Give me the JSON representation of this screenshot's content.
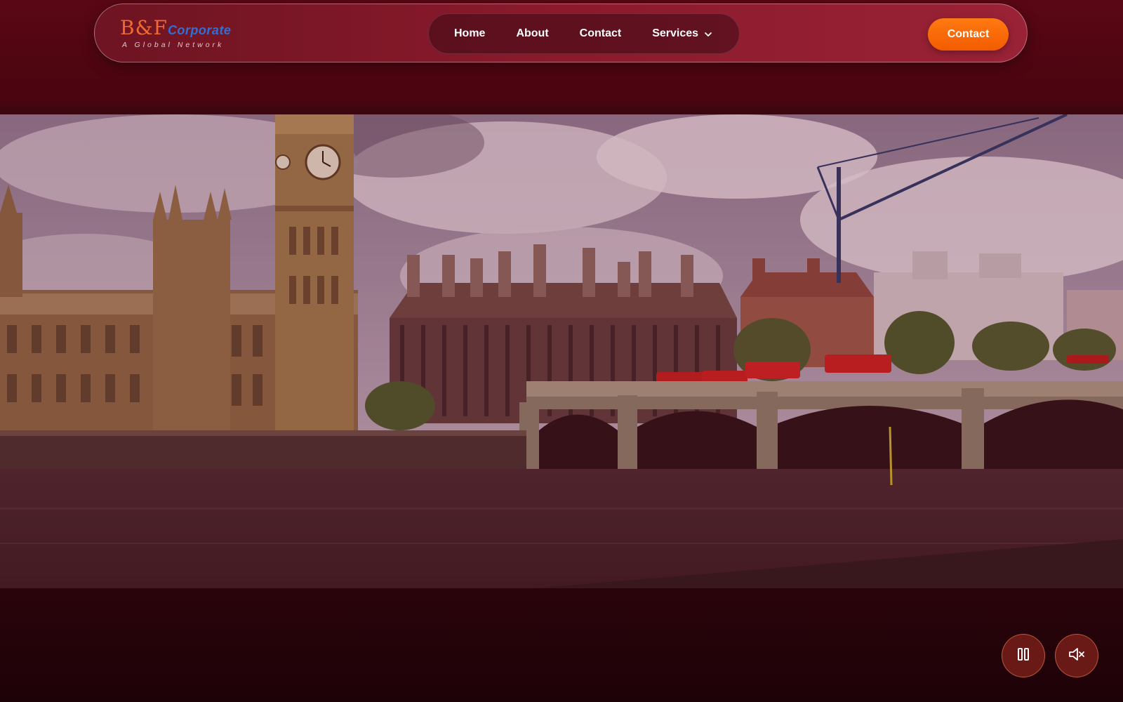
{
  "brand": {
    "logo_mark": "B&F",
    "logo_word": "Corporate",
    "tagline": "A Global Network"
  },
  "nav": {
    "items": [
      {
        "label": "Home"
      },
      {
        "label": "About"
      },
      {
        "label": "Contact"
      },
      {
        "label": "Services",
        "icon": "chevron-down-icon"
      }
    ],
    "cta_label": "Contact"
  },
  "hero": {
    "media": "video-background-westminster-london",
    "controls": {
      "pause_icon": "pause-icon",
      "mute_icon": "volume-muted-icon"
    }
  },
  "colors": {
    "accent": "#f25c00",
    "nav_bg": "#8a1a2c",
    "page_bg": "#2a040a",
    "logo_orange": "#f06a30",
    "logo_blue": "#2f6fd8"
  }
}
